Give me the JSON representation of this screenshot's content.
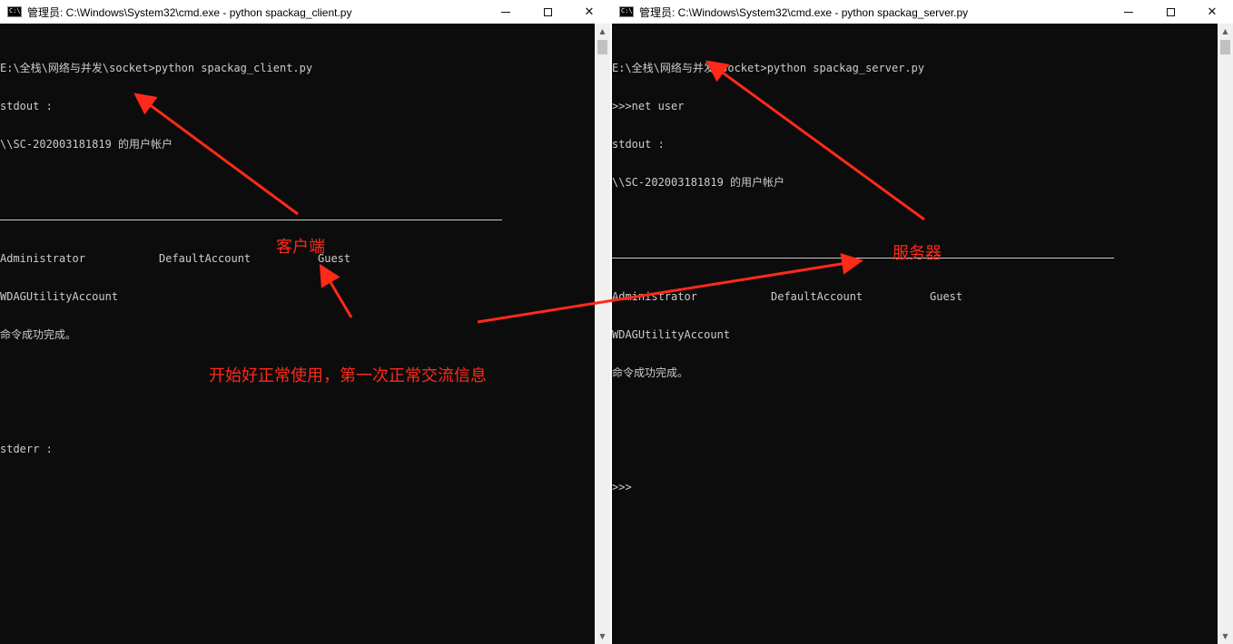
{
  "left_window": {
    "title": "管理员: C:\\Windows\\System32\\cmd.exe - python  spackag_client.py",
    "lines": [
      "E:\\全栈\\网络与并发\\socket>python spackag_client.py",
      "stdout :",
      "\\\\SC-202003181819 的用户帐户"
    ],
    "accounts_row1": [
      "Administrator",
      "DefaultAccount",
      "Guest"
    ],
    "accounts_row2": "WDAGUtilityAccount",
    "success": "命令成功完成。",
    "stderr": "stderr :"
  },
  "right_window": {
    "title": "管理员: C:\\Windows\\System32\\cmd.exe - python  spackag_server.py",
    "lines": [
      "E:\\全栈\\网络与并发\\socket>python spackag_server.py",
      ">>>net user",
      "stdout :",
      "\\\\SC-202003181819 的用户帐户"
    ],
    "accounts_row1": [
      "Administrator",
      "DefaultAccount",
      "Guest"
    ],
    "accounts_row2": "WDAGUtilityAccount",
    "success": "命令成功完成。",
    "prompt": ">>>"
  },
  "window_controls": {
    "close": "✕"
  },
  "annotations": {
    "client": "客户端",
    "server": "服务器",
    "normal": "开始好正常使用，第一次正常交流信息",
    "color": "#ff2a1a"
  },
  "colors": {
    "console_bg": "#0c0c0c",
    "console_text": "#cccccc"
  }
}
